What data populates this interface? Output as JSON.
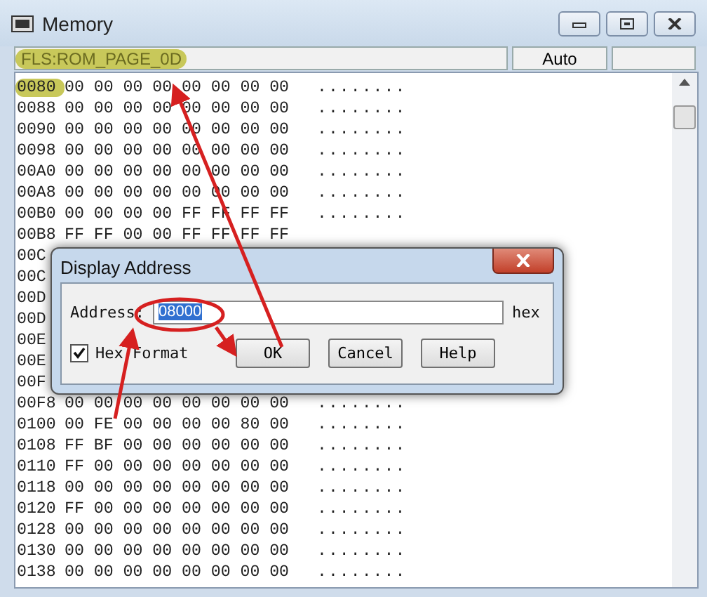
{
  "window": {
    "title": "Memory"
  },
  "location": {
    "text": "FLS:ROM_PAGE_0D",
    "highlighted": true
  },
  "mode": "Auto",
  "rows": [
    {
      "address": "0080",
      "highlighted": true,
      "bytes": "00 00 00 00 00 00 00 00",
      "ascii": "........"
    },
    {
      "address": "0088",
      "highlighted": false,
      "bytes": "00 00 00 00 00 00 00 00",
      "ascii": "........"
    },
    {
      "address": "0090",
      "highlighted": false,
      "bytes": "00 00 00 00 00 00 00 00",
      "ascii": "........"
    },
    {
      "address": "0098",
      "highlighted": false,
      "bytes": "00 00 00 00 00 00 00 00",
      "ascii": "........"
    },
    {
      "address": "00A0",
      "highlighted": false,
      "bytes": "00 00 00 00 00 00 00 00",
      "ascii": "........"
    },
    {
      "address": "00A8",
      "highlighted": false,
      "bytes": "00 00 00 00 00 00 00 00",
      "ascii": "........"
    },
    {
      "address": "00B0",
      "highlighted": false,
      "bytes": "00 00 00 00 FF FF FF FF",
      "ascii": "........"
    },
    {
      "address": "00B8",
      "highlighted": false,
      "bytes": "FF FF 00 00 FF FF FF FF"
    },
    {
      "address": "00C",
      "highlighted": false
    },
    {
      "address": "00C",
      "highlighted": false
    },
    {
      "address": "00D",
      "highlighted": false
    },
    {
      "address": "00D",
      "highlighted": false
    },
    {
      "address": "00E",
      "highlighted": false
    },
    {
      "address": "00E",
      "highlighted": false
    },
    {
      "address": "00F",
      "highlighted": false
    },
    {
      "address": "00F8",
      "highlighted": false,
      "bytes": "00 00 00 00 00 00 00 00",
      "ascii": "........"
    },
    {
      "address": "0100",
      "highlighted": false,
      "bytes": "00 FE 00 00 00 00 80 00",
      "ascii": "........"
    },
    {
      "address": "0108",
      "highlighted": false,
      "bytes": "FF BF 00 00 00 00 00 00",
      "ascii": "........"
    },
    {
      "address": "0110",
      "highlighted": false,
      "bytes": "FF 00 00 00 00 00 00 00",
      "ascii": "........"
    },
    {
      "address": "0118",
      "highlighted": false,
      "bytes": "00 00 00 00 00 00 00 00",
      "ascii": "........"
    },
    {
      "address": "0120",
      "highlighted": false,
      "bytes": "FF 00 00 00 00 00 00 00",
      "ascii": "........"
    },
    {
      "address": "0128",
      "highlighted": false,
      "bytes": "00 00 00 00 00 00 00 00",
      "ascii": "........"
    },
    {
      "address": "0130",
      "highlighted": false,
      "bytes": "00 00 00 00 00 00 00 00",
      "ascii": "........"
    },
    {
      "address": "0138",
      "highlighted": false,
      "bytes": "00 00 00 00 00 00 00 00",
      "ascii": "........"
    }
  ],
  "dialog": {
    "title": "Display Address",
    "address_label": "Address:",
    "address_value": "08000",
    "value_selected": true,
    "unit": "hex",
    "hex_format": {
      "label": "Hex Format",
      "checked": true
    },
    "buttons": [
      "OK",
      "Cancel",
      "Help"
    ]
  }
}
